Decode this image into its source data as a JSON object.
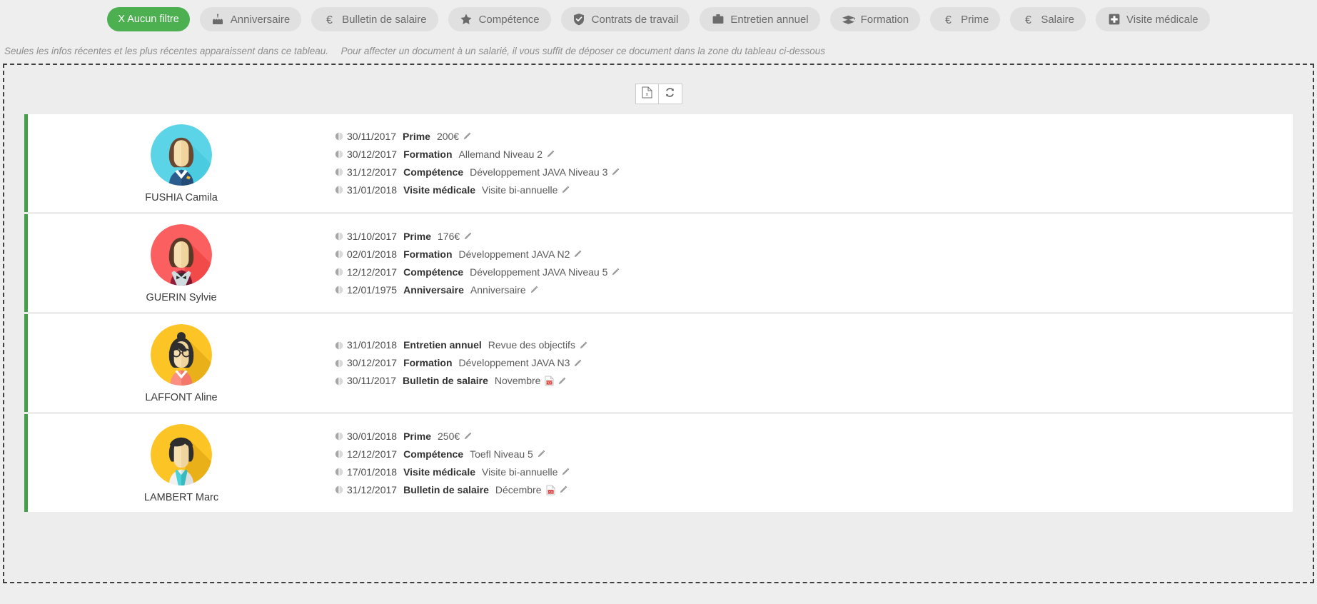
{
  "colors": {
    "active_filter_bg": "#4caf50",
    "chip_bg": "#e0e0e0",
    "chip_text": "#6b6b6b",
    "row_accent": "#43a047",
    "page_bg": "#eeeeee",
    "row_bg": "#ffffff"
  },
  "filters": [
    {
      "label": "X Aucun filtre",
      "icon": "clear-filter-icon",
      "active": true
    },
    {
      "label": "Anniversaire",
      "icon": "cake-icon",
      "active": false
    },
    {
      "label": "Bulletin de salaire",
      "icon": "euro-icon",
      "active": false
    },
    {
      "label": "Compétence",
      "icon": "star-icon",
      "active": false
    },
    {
      "label": "Contrats de travail",
      "icon": "shield-check-icon",
      "active": false
    },
    {
      "label": "Entretien annuel",
      "icon": "briefcase-icon",
      "active": false
    },
    {
      "label": "Formation",
      "icon": "graduation-cap-icon",
      "active": false
    },
    {
      "label": "Prime",
      "icon": "euro-icon",
      "active": false
    },
    {
      "label": "Salaire",
      "icon": "euro-icon",
      "active": false
    },
    {
      "label": "Visite médicale",
      "icon": "medical-cross-icon",
      "active": false
    }
  ],
  "info": {
    "part1": "Seules les infos récentes et les plus récentes apparaissent dans ce tableau.",
    "part2": "Pour affecter un document à un salarié, il vous suffit de déposer ce document dans la zone du tableau ci-dessous"
  },
  "toolbar": {
    "export_label": "export-excel",
    "export_icon": "excel-file-icon",
    "refresh_label": "refresh",
    "refresh_icon": "refresh-icon"
  },
  "employees": [
    {
      "name": "FUSHIA Camila",
      "avatar": "avatar-stewardess",
      "events": [
        {
          "date": "30/11/2017",
          "type": "Prime",
          "value": "200€",
          "pdf": false
        },
        {
          "date": "30/12/2017",
          "type": "Formation",
          "value": "Allemand Niveau 2",
          "pdf": false
        },
        {
          "date": "31/12/2017",
          "type": "Compétence",
          "value": "Développement JAVA Niveau 3",
          "pdf": false
        },
        {
          "date": "31/01/2018",
          "type": "Visite médicale",
          "value": "Visite bi-annuelle",
          "pdf": false
        }
      ]
    },
    {
      "name": "GUERIN Sylvie",
      "avatar": "avatar-red-bowtie",
      "events": [
        {
          "date": "31/10/2017",
          "type": "Prime",
          "value": "176€",
          "pdf": false
        },
        {
          "date": "02/01/2018",
          "type": "Formation",
          "value": "Développement JAVA N2",
          "pdf": false
        },
        {
          "date": "12/12/2017",
          "type": "Compétence",
          "value": "Développement JAVA Niveau 5",
          "pdf": false
        },
        {
          "date": "12/01/1975",
          "type": "Anniversaire",
          "value": "Anniversaire",
          "pdf": false
        }
      ]
    },
    {
      "name": "LAFFONT Aline",
      "avatar": "avatar-glasses-bun",
      "events": [
        {
          "date": "31/01/2018",
          "type": "Entretien annuel",
          "value": "Revue des objectifs",
          "pdf": false
        },
        {
          "date": "30/12/2017",
          "type": "Formation",
          "value": "Développement JAVA N3",
          "pdf": false
        },
        {
          "date": "30/11/2017",
          "type": "Bulletin de salaire",
          "value": "Novembre",
          "pdf": true
        }
      ]
    },
    {
      "name": "LAMBERT Marc",
      "avatar": "avatar-doctor",
      "events": [
        {
          "date": "30/01/2018",
          "type": "Prime",
          "value": "250€",
          "pdf": false
        },
        {
          "date": "12/12/2017",
          "type": "Compétence",
          "value": "Toefl Niveau 5",
          "pdf": false
        },
        {
          "date": "17/01/2018",
          "type": "Visite médicale",
          "value": "Visite bi-annuelle",
          "pdf": false
        },
        {
          "date": "31/12/2017",
          "type": "Bulletin de salaire",
          "value": "Décembre",
          "pdf": true
        }
      ]
    }
  ]
}
